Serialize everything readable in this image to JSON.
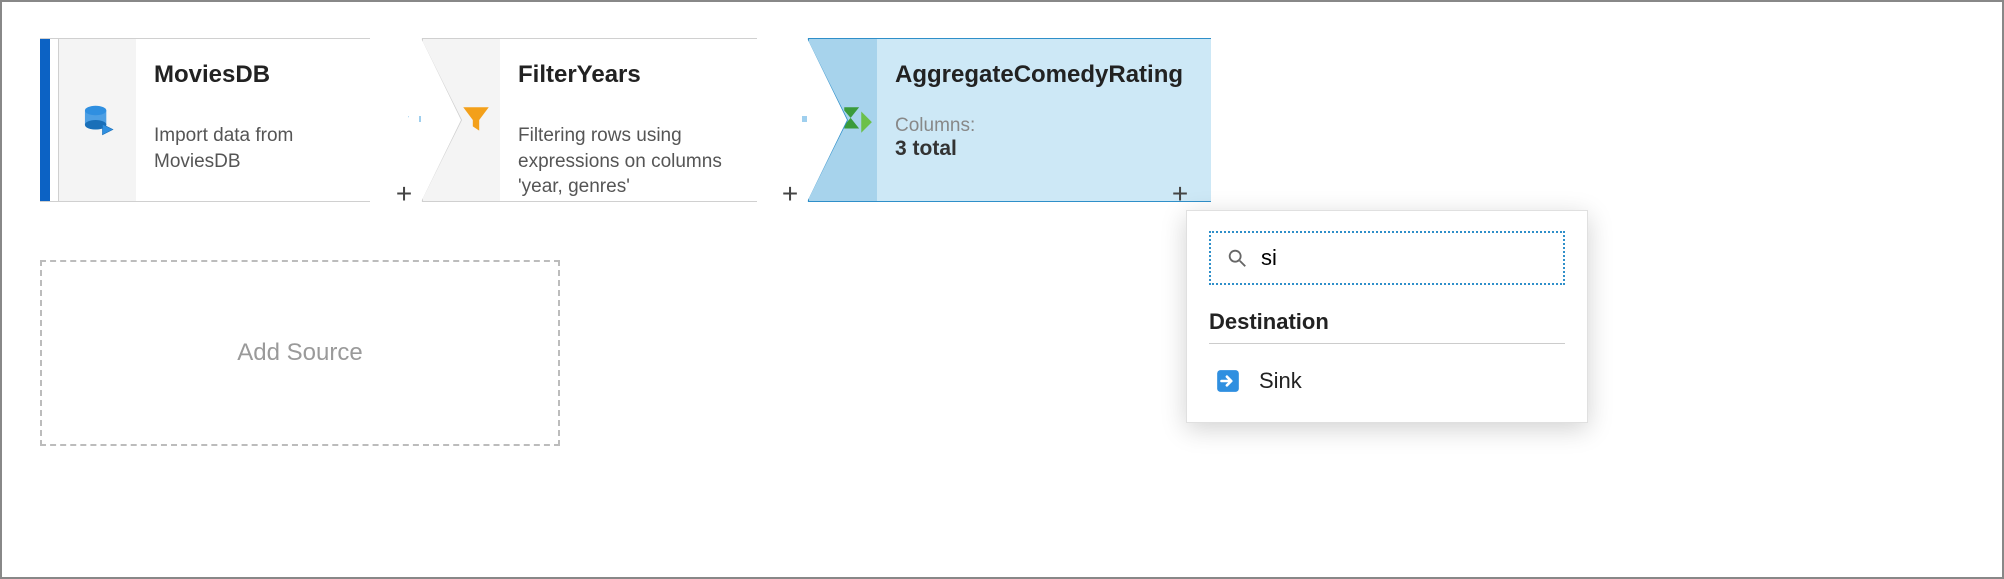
{
  "nodes": {
    "source": {
      "title": "MoviesDB",
      "desc": "Import data from MoviesDB"
    },
    "filter": {
      "title": "FilterYears",
      "desc": "Filtering rows using expressions on columns 'year, genres'"
    },
    "aggregate": {
      "title": "AggregateComedyRating",
      "cols_label": "Columns:",
      "cols_value": "3 total"
    }
  },
  "add_source_label": "Add Source",
  "plus_label": "+",
  "popup": {
    "search_value": "si",
    "section": "Destination",
    "items": [
      {
        "label": "Sink"
      }
    ]
  }
}
